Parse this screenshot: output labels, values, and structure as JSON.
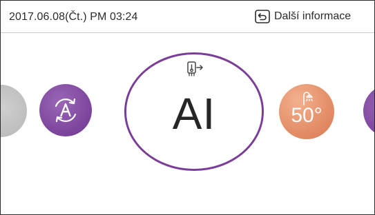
{
  "header": {
    "datetime": "2017.06.08(Čt.)  PM 03:24",
    "more_info_label": "Další informace"
  },
  "modes": [
    {
      "name": "previous-mode",
      "color": "#bdbdbd"
    },
    {
      "name": "auto-mode",
      "icon": "auto-cycle-icon",
      "color": "#7b3e98"
    },
    {
      "name": "ai-mode",
      "label": "AI",
      "icon": "heater-transfer-icon",
      "selected": true,
      "accent": "#7b3e98"
    },
    {
      "name": "shower-mode",
      "icon": "shower-icon",
      "temperature": "50°",
      "color": "#e08a62"
    },
    {
      "name": "next-mode",
      "color": "#7b3e98"
    }
  ],
  "icons": {
    "more_info": "return-arrow-icon"
  }
}
